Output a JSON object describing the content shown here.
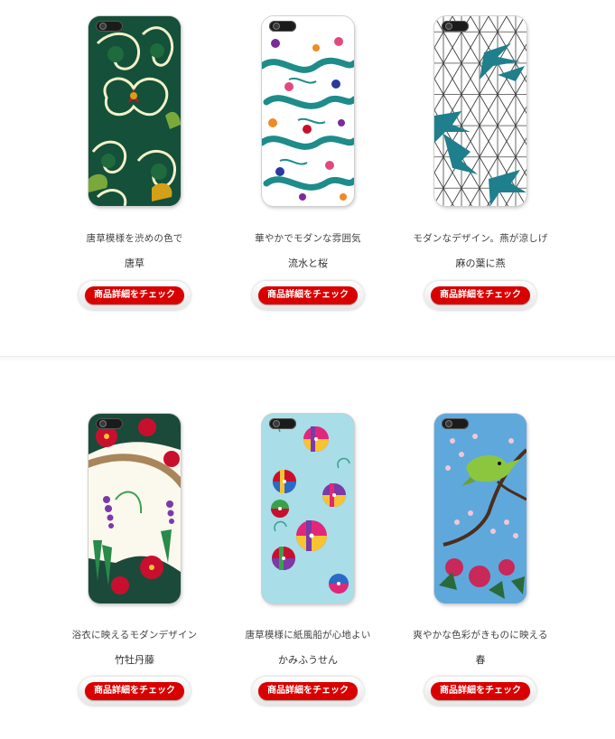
{
  "products": [
    {
      "description": "唐草模様を渋めの色で",
      "name": "唐草",
      "button_label": "商品詳細をチェック",
      "pattern": "karakusa-green"
    },
    {
      "description": "華やかでモダンな雰囲気",
      "name": "流水と桜",
      "button_label": "商品詳細をチェック",
      "pattern": "ryusui-sakura"
    },
    {
      "description": "モダンなデザイン。燕が涼しげ",
      "name": "麻の葉に燕",
      "button_label": "商品詳細をチェック",
      "pattern": "asanoha-tsubame"
    },
    {
      "description": "浴衣に映えるモダンデザイン",
      "name": "竹牡丹藤",
      "button_label": "商品詳細をチェック",
      "pattern": "take-botan-fuji"
    },
    {
      "description": "唐草模様に紙風船が心地よい",
      "name": "かみふうせん",
      "button_label": "商品詳細をチェック",
      "pattern": "kamifusen"
    },
    {
      "description": "爽やかな色彩がきものに映える",
      "name": "春",
      "button_label": "商品詳細をチェック",
      "pattern": "haru-uguisu"
    }
  ],
  "colors": {
    "button": "#d90000",
    "button_text": "#ffffff",
    "divider": "#ececec"
  }
}
